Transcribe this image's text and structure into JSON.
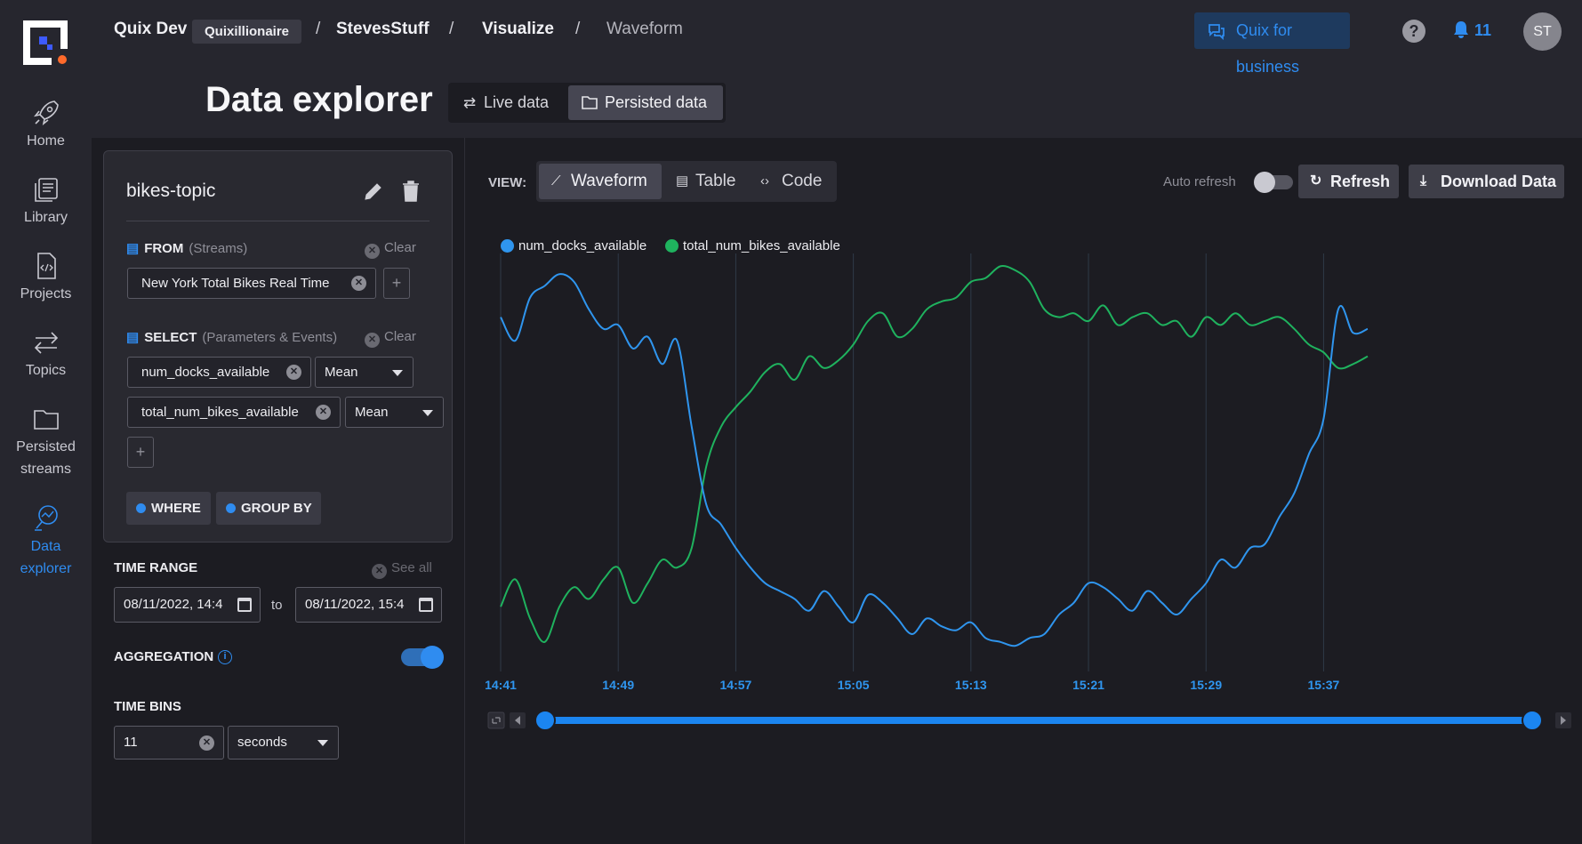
{
  "header": {
    "breadcrumb": {
      "org": "Quix Dev",
      "workspace_chip": "Quixillionaire",
      "project": "StevesStuff",
      "section": "Visualize",
      "page": "Waveform"
    },
    "business_button": "Quix for business",
    "notifications_count": "11",
    "avatar_initials": "ST"
  },
  "leftnav": {
    "items": [
      {
        "label": "Home",
        "icon": "rocket-icon"
      },
      {
        "label": "Library",
        "icon": "library-icon"
      },
      {
        "label": "Projects",
        "icon": "code-file-icon"
      },
      {
        "label": "Topics",
        "icon": "arrows-icon"
      },
      {
        "label": "Persisted streams",
        "icon": "folder-icon"
      },
      {
        "label": "Data explorer",
        "icon": "chart-search-icon",
        "active": true
      }
    ]
  },
  "page": {
    "title": "Data explorer",
    "modes": [
      "Live data",
      "Persisted data"
    ],
    "active_mode": "Persisted data"
  },
  "query": {
    "topic": "bikes-topic",
    "from_label": "FROM",
    "from_sub": "(Streams)",
    "clear_label": "Clear",
    "from_streams": [
      "New York Total Bikes Real Time"
    ],
    "select_label": "SELECT",
    "select_sub": "(Parameters & Events)",
    "parameters": [
      {
        "name": "num_docks_available",
        "aggregation": "Mean"
      },
      {
        "name": "total_num_bikes_available",
        "aggregation": "Mean"
      }
    ],
    "where_label": "WHERE",
    "group_by_label": "GROUP BY"
  },
  "time_range": {
    "label": "TIME RANGE",
    "see_all": "See all",
    "from": "08/11/2022, 14:4",
    "to_label": "to",
    "to": "08/11/2022, 15:4"
  },
  "aggregation": {
    "label": "AGGREGATION",
    "enabled": true
  },
  "time_bins": {
    "label": "TIME BINS",
    "value": "11",
    "unit": "seconds"
  },
  "view": {
    "label": "VIEW:",
    "tabs": [
      "Waveform",
      "Table",
      "Code"
    ],
    "active": "Waveform",
    "auto_refresh_label": "Auto refresh",
    "auto_refresh": false,
    "refresh_button": "Refresh",
    "download_button": "Download Data"
  },
  "colors": {
    "accent": "#2f8cf0",
    "series_blue": "#2f95ee",
    "series_green": "#1fb25e"
  },
  "chart_data": {
    "type": "line",
    "title": "",
    "xlabel": "",
    "ylabel": "",
    "x_ticks": [
      "14:41",
      "14:49",
      "14:57",
      "15:05",
      "15:13",
      "15:21",
      "15:29",
      "15:37"
    ],
    "x": [
      "14:41",
      "14:42",
      "14:43",
      "14:44",
      "14:45",
      "14:46",
      "14:47",
      "14:48",
      "14:49",
      "14:50",
      "14:51",
      "14:52",
      "14:53",
      "14:54",
      "14:55",
      "14:56",
      "14:57",
      "14:58",
      "14:59",
      "15:00",
      "15:01",
      "15:02",
      "15:03",
      "15:04",
      "15:05",
      "15:06",
      "15:07",
      "15:08",
      "15:09",
      "15:10",
      "15:11",
      "15:12",
      "15:13",
      "15:14",
      "15:15",
      "15:16",
      "15:17",
      "15:18",
      "15:19",
      "15:20",
      "15:21",
      "15:22",
      "15:23",
      "15:24",
      "15:25",
      "15:26",
      "15:27",
      "15:28",
      "15:29",
      "15:30",
      "15:31",
      "15:32",
      "15:33",
      "15:34",
      "15:35",
      "15:36",
      "15:37",
      "15:38",
      "15:39",
      "15:40"
    ],
    "series": [
      {
        "name": "num_docks_available",
        "color": "#2f95ee",
        "values": [
          86,
          80,
          91,
          94,
          97,
          95,
          88,
          83,
          84,
          78,
          81,
          74,
          80,
          58,
          38,
          33,
          27,
          22,
          18,
          16,
          14,
          11,
          16,
          12,
          8,
          15,
          13,
          9,
          5,
          9,
          7,
          6,
          8,
          4,
          3,
          2,
          4,
          5,
          10,
          13,
          18,
          17,
          14,
          11,
          16,
          13,
          10,
          14,
          18,
          24,
          22,
          27,
          28,
          35,
          41,
          51,
          60,
          88,
          82,
          83
        ],
        "visible_range": [
          0,
          100
        ]
      },
      {
        "name": "total_num_bikes_available",
        "color": "#1fb25e",
        "values": [
          12,
          19,
          9,
          3,
          12,
          17,
          14,
          19,
          22,
          13,
          18,
          24,
          22,
          27,
          48,
          58,
          63,
          67,
          72,
          74,
          70,
          76,
          73,
          75,
          79,
          85,
          87,
          81,
          83,
          88,
          90,
          91,
          95,
          96,
          99,
          98,
          95,
          88,
          86,
          87,
          85,
          89,
          84,
          86,
          87,
          84,
          85,
          81,
          86,
          84,
          87,
          84,
          85,
          86,
          83,
          79,
          77,
          73,
          74,
          76
        ],
        "visible_range": [
          0,
          100
        ]
      }
    ],
    "legend_position": "top-left",
    "grid": "vertical"
  }
}
